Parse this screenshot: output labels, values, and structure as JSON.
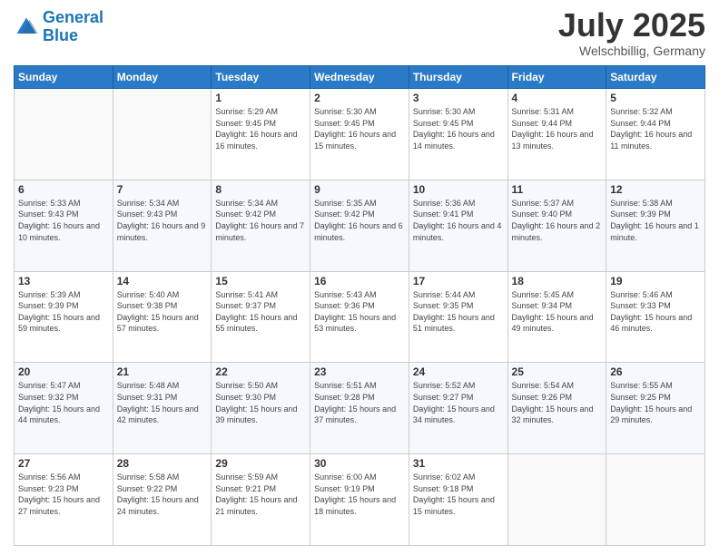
{
  "logo": {
    "line1": "General",
    "line2": "Blue"
  },
  "title": "July 2025",
  "location": "Welschbillig, Germany",
  "days_header": [
    "Sunday",
    "Monday",
    "Tuesday",
    "Wednesday",
    "Thursday",
    "Friday",
    "Saturday"
  ],
  "weeks": [
    [
      {
        "day": "",
        "info": ""
      },
      {
        "day": "",
        "info": ""
      },
      {
        "day": "1",
        "info": "Sunrise: 5:29 AM\nSunset: 9:45 PM\nDaylight: 16 hours and 16 minutes."
      },
      {
        "day": "2",
        "info": "Sunrise: 5:30 AM\nSunset: 9:45 PM\nDaylight: 16 hours and 15 minutes."
      },
      {
        "day": "3",
        "info": "Sunrise: 5:30 AM\nSunset: 9:45 PM\nDaylight: 16 hours and 14 minutes."
      },
      {
        "day": "4",
        "info": "Sunrise: 5:31 AM\nSunset: 9:44 PM\nDaylight: 16 hours and 13 minutes."
      },
      {
        "day": "5",
        "info": "Sunrise: 5:32 AM\nSunset: 9:44 PM\nDaylight: 16 hours and 11 minutes."
      }
    ],
    [
      {
        "day": "6",
        "info": "Sunrise: 5:33 AM\nSunset: 9:43 PM\nDaylight: 16 hours and 10 minutes."
      },
      {
        "day": "7",
        "info": "Sunrise: 5:34 AM\nSunset: 9:43 PM\nDaylight: 16 hours and 9 minutes."
      },
      {
        "day": "8",
        "info": "Sunrise: 5:34 AM\nSunset: 9:42 PM\nDaylight: 16 hours and 7 minutes."
      },
      {
        "day": "9",
        "info": "Sunrise: 5:35 AM\nSunset: 9:42 PM\nDaylight: 16 hours and 6 minutes."
      },
      {
        "day": "10",
        "info": "Sunrise: 5:36 AM\nSunset: 9:41 PM\nDaylight: 16 hours and 4 minutes."
      },
      {
        "day": "11",
        "info": "Sunrise: 5:37 AM\nSunset: 9:40 PM\nDaylight: 16 hours and 2 minutes."
      },
      {
        "day": "12",
        "info": "Sunrise: 5:38 AM\nSunset: 9:39 PM\nDaylight: 16 hours and 1 minute."
      }
    ],
    [
      {
        "day": "13",
        "info": "Sunrise: 5:39 AM\nSunset: 9:39 PM\nDaylight: 15 hours and 59 minutes."
      },
      {
        "day": "14",
        "info": "Sunrise: 5:40 AM\nSunset: 9:38 PM\nDaylight: 15 hours and 57 minutes."
      },
      {
        "day": "15",
        "info": "Sunrise: 5:41 AM\nSunset: 9:37 PM\nDaylight: 15 hours and 55 minutes."
      },
      {
        "day": "16",
        "info": "Sunrise: 5:43 AM\nSunset: 9:36 PM\nDaylight: 15 hours and 53 minutes."
      },
      {
        "day": "17",
        "info": "Sunrise: 5:44 AM\nSunset: 9:35 PM\nDaylight: 15 hours and 51 minutes."
      },
      {
        "day": "18",
        "info": "Sunrise: 5:45 AM\nSunset: 9:34 PM\nDaylight: 15 hours and 49 minutes."
      },
      {
        "day": "19",
        "info": "Sunrise: 5:46 AM\nSunset: 9:33 PM\nDaylight: 15 hours and 46 minutes."
      }
    ],
    [
      {
        "day": "20",
        "info": "Sunrise: 5:47 AM\nSunset: 9:32 PM\nDaylight: 15 hours and 44 minutes."
      },
      {
        "day": "21",
        "info": "Sunrise: 5:48 AM\nSunset: 9:31 PM\nDaylight: 15 hours and 42 minutes."
      },
      {
        "day": "22",
        "info": "Sunrise: 5:50 AM\nSunset: 9:30 PM\nDaylight: 15 hours and 39 minutes."
      },
      {
        "day": "23",
        "info": "Sunrise: 5:51 AM\nSunset: 9:28 PM\nDaylight: 15 hours and 37 minutes."
      },
      {
        "day": "24",
        "info": "Sunrise: 5:52 AM\nSunset: 9:27 PM\nDaylight: 15 hours and 34 minutes."
      },
      {
        "day": "25",
        "info": "Sunrise: 5:54 AM\nSunset: 9:26 PM\nDaylight: 15 hours and 32 minutes."
      },
      {
        "day": "26",
        "info": "Sunrise: 5:55 AM\nSunset: 9:25 PM\nDaylight: 15 hours and 29 minutes."
      }
    ],
    [
      {
        "day": "27",
        "info": "Sunrise: 5:56 AM\nSunset: 9:23 PM\nDaylight: 15 hours and 27 minutes."
      },
      {
        "day": "28",
        "info": "Sunrise: 5:58 AM\nSunset: 9:22 PM\nDaylight: 15 hours and 24 minutes."
      },
      {
        "day": "29",
        "info": "Sunrise: 5:59 AM\nSunset: 9:21 PM\nDaylight: 15 hours and 21 minutes."
      },
      {
        "day": "30",
        "info": "Sunrise: 6:00 AM\nSunset: 9:19 PM\nDaylight: 15 hours and 18 minutes."
      },
      {
        "day": "31",
        "info": "Sunrise: 6:02 AM\nSunset: 9:18 PM\nDaylight: 15 hours and 15 minutes."
      },
      {
        "day": "",
        "info": ""
      },
      {
        "day": "",
        "info": ""
      }
    ]
  ]
}
